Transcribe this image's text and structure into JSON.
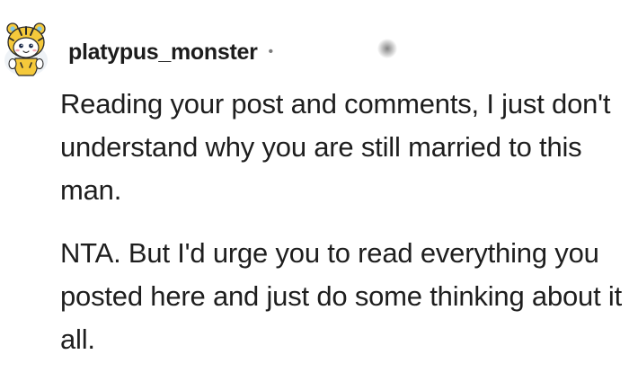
{
  "comment": {
    "author": {
      "username": "platypus_monster",
      "avatar_icon": "tiger-snoo-avatar-icon"
    },
    "separator": "•",
    "timestamp": "",
    "body": {
      "paragraphs": [
        "Reading your post and comments, I just don't understand why you are still married to this man.",
        "NTA. But I'd urge you to read everything you posted here and just do some thinking about it all."
      ]
    }
  },
  "colors": {
    "text": "#1e1e1e",
    "meta": "#7c7c7c",
    "avatar_yellow": "#f5c93b",
    "avatar_face": "#ffffff"
  }
}
